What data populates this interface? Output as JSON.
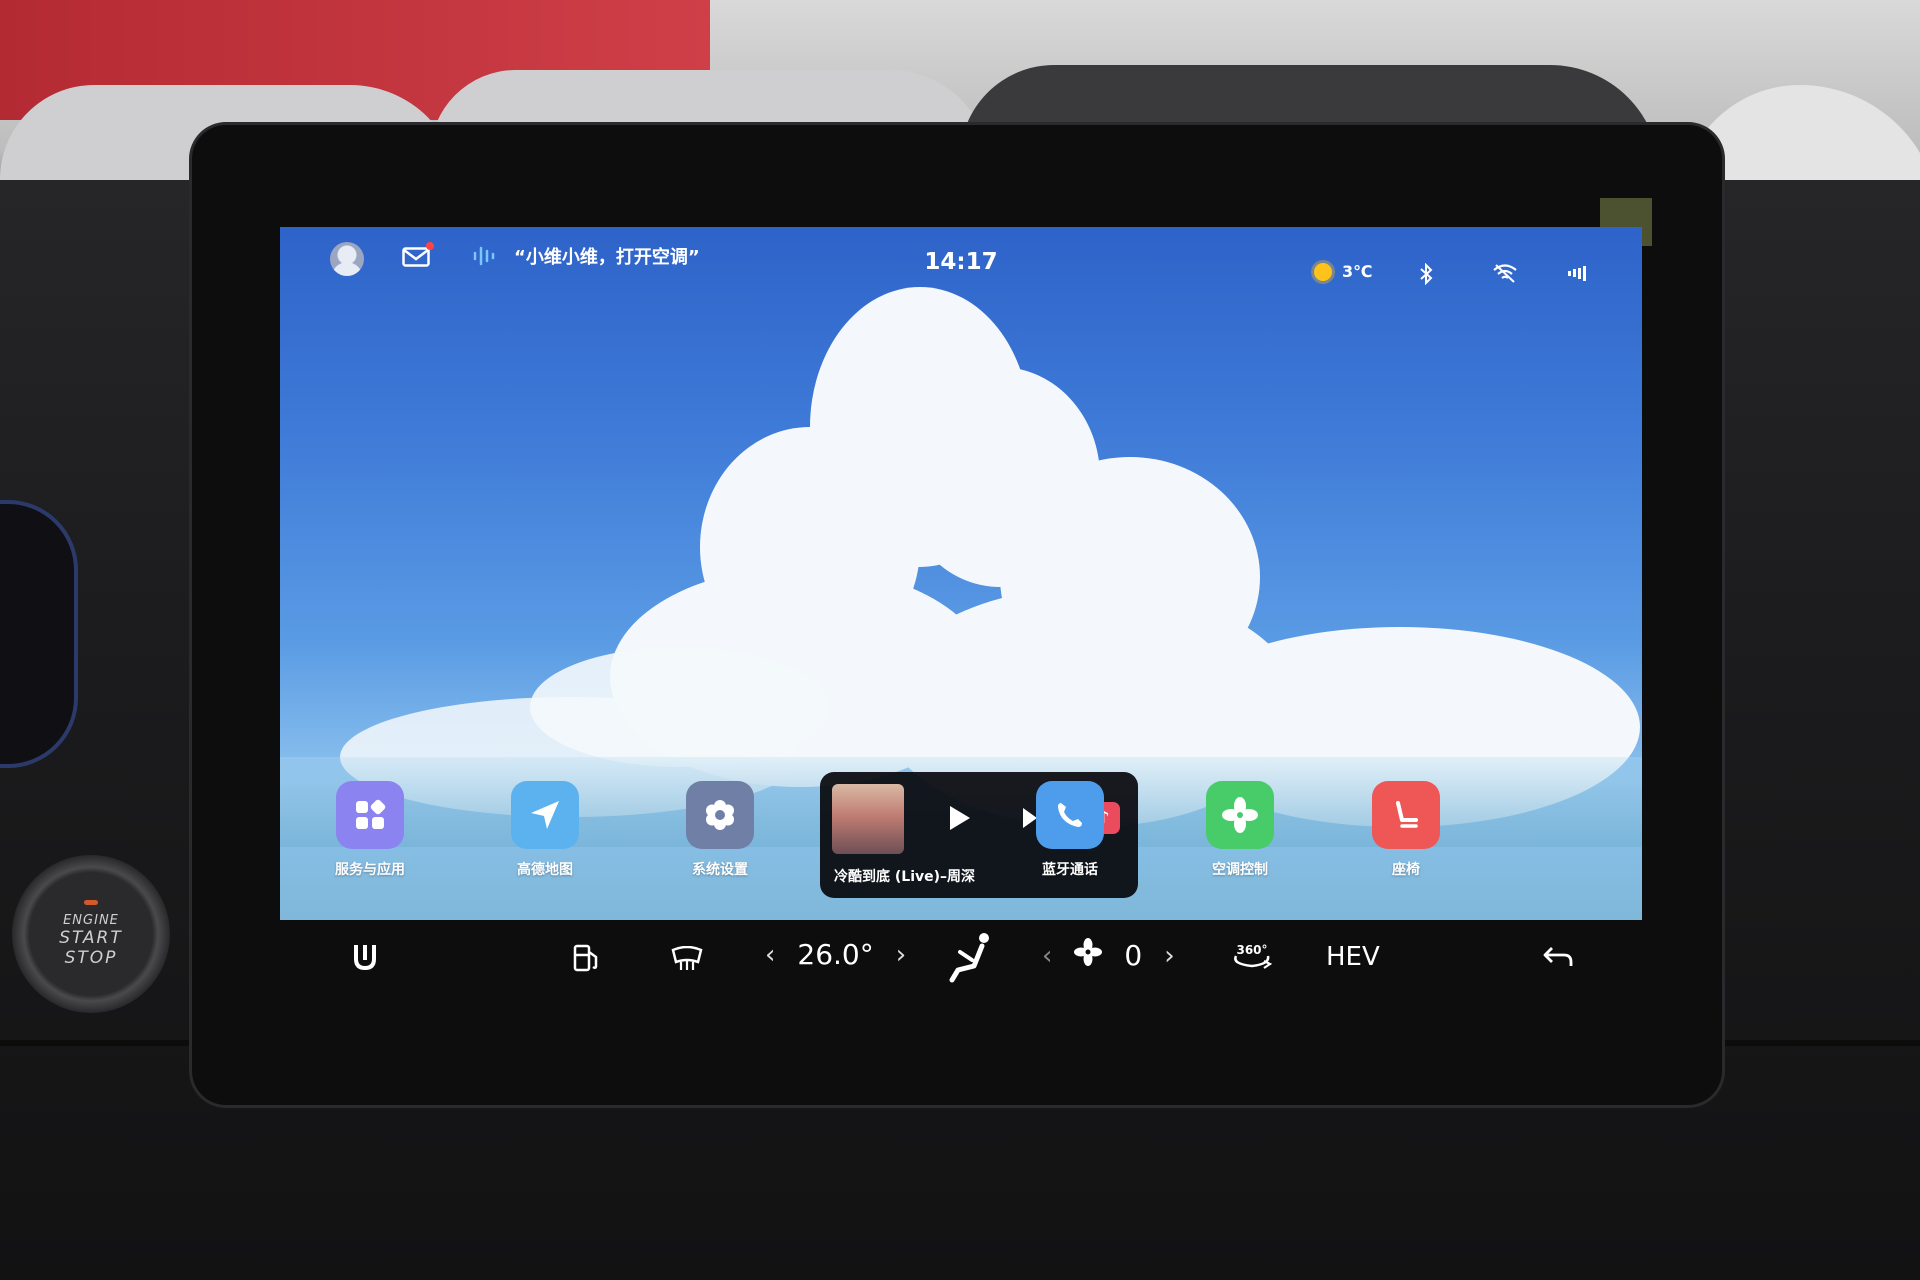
{
  "status_bar": {
    "voice_hint": "“小维小维，打开空调”",
    "time": "14:17",
    "temperature": "3℃",
    "icons": [
      "avatar-icon",
      "mail-icon",
      "voice-wave-icon",
      "sun-icon",
      "bluetooth-icon",
      "wifi-icon",
      "signal-icon"
    ]
  },
  "dock": {
    "apps": [
      {
        "label": "服务与应用",
        "icon": "grid-icon",
        "color": "#8b84f0"
      },
      {
        "label": "高德地图",
        "icon": "navigation-arrow-icon",
        "color": "#5cb2ee"
      },
      {
        "label": "系统设置",
        "icon": "gear-icon",
        "color": "#6f7fa6"
      },
      {
        "label": "蓝牙通话",
        "icon": "phone-icon",
        "color": "#4e9ded"
      },
      {
        "label": "空调控制",
        "icon": "fan-icon",
        "color": "#48cc6a"
      },
      {
        "label": "座椅",
        "icon": "seat-icon",
        "color": "#ef5757"
      }
    ],
    "media": {
      "track": "冷酷到底 (Live)–周深",
      "icons": [
        "album-cover",
        "play-icon",
        "next-track-icon",
        "music-app-icon"
      ]
    }
  },
  "control_bar": {
    "temperature": "26.0°",
    "fan_speed": "0",
    "camera_label": "360°",
    "mode": "HEV",
    "icons": [
      "home-icon",
      "fuel-icon",
      "rear-defrost-icon",
      "seat-airflow-icon",
      "fan-icon",
      "camera-360-icon",
      "back-icon"
    ]
  },
  "hardware": {
    "start_button_line1": "ENGINE",
    "start_button_line2": "START",
    "start_button_line3": "STOP"
  },
  "colors": {
    "sky": "#3f7bd8",
    "media_bg": "#08080c",
    "accent_music": "#ea4c5e"
  }
}
